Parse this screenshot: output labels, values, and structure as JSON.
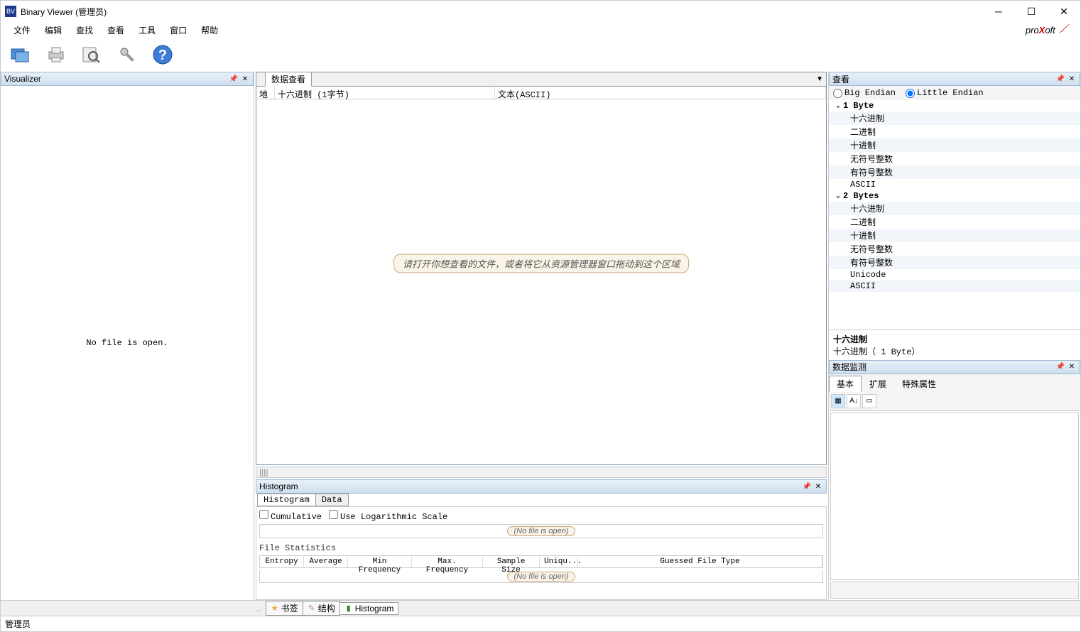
{
  "title": "Binary Viewer (管理员)",
  "menu": {
    "file": "文件",
    "edit": "编辑",
    "find": "查找",
    "view": "查看",
    "tools": "工具",
    "window": "窗口",
    "help": "帮助"
  },
  "brand": {
    "pre": "pro",
    "x": "X",
    "post": "oft"
  },
  "toolbar_icons": {
    "open": "open-icon",
    "print": "print-icon",
    "search": "search-icon",
    "settings": "settings-icon",
    "help": "help-icon"
  },
  "visualizer": {
    "title": "Visualizer",
    "empty": "No file is open."
  },
  "center": {
    "tab": "数据查看",
    "headers": {
      "addr": "地",
      "hex": "十六进制 (1字节)",
      "text": "文本(ASCII)"
    },
    "placeholder": "请打开你想查看的文件，或者将它从资源管理器窗口拖动到这个区域"
  },
  "histogram": {
    "title": "Histogram",
    "tab_hist": "Histogram",
    "tab_data": "Data",
    "cumulative": "Cumulative",
    "logscale": "Use Logarithmic Scale",
    "nofile": "(No file is open)",
    "stats_label": "File Statistics",
    "stats_cols": {
      "entropy": "Entropy",
      "average": "Average",
      "minf": "Min Frequency",
      "maxf": "Max. Frequency",
      "sample": "Sample Size",
      "uniq": "Uniqu...",
      "guess": "Guessed File Type"
    }
  },
  "bottom_tabs": {
    "bookmark": "书签",
    "structure": "结构",
    "histogram": "Histogram"
  },
  "view_panel": {
    "title": "查看",
    "big": "Big Endian",
    "little": "Little Endian",
    "group1": "1 Byte",
    "group2": "2 Bytes",
    "items": {
      "hex": "十六进制",
      "bin": "二进制",
      "dec": "十进制",
      "uint": "无符号整数",
      "sint": "有符号整数",
      "ascii": "ASCII",
      "unicode": "Unicode"
    },
    "detail_title": "十六进制",
    "detail_sub": "十六进制（ 1 Byte）"
  },
  "monitor": {
    "title": "数据监测",
    "tab_basic": "基本",
    "tab_ext": "扩展",
    "tab_special": "特殊属性"
  },
  "status": "管理员"
}
